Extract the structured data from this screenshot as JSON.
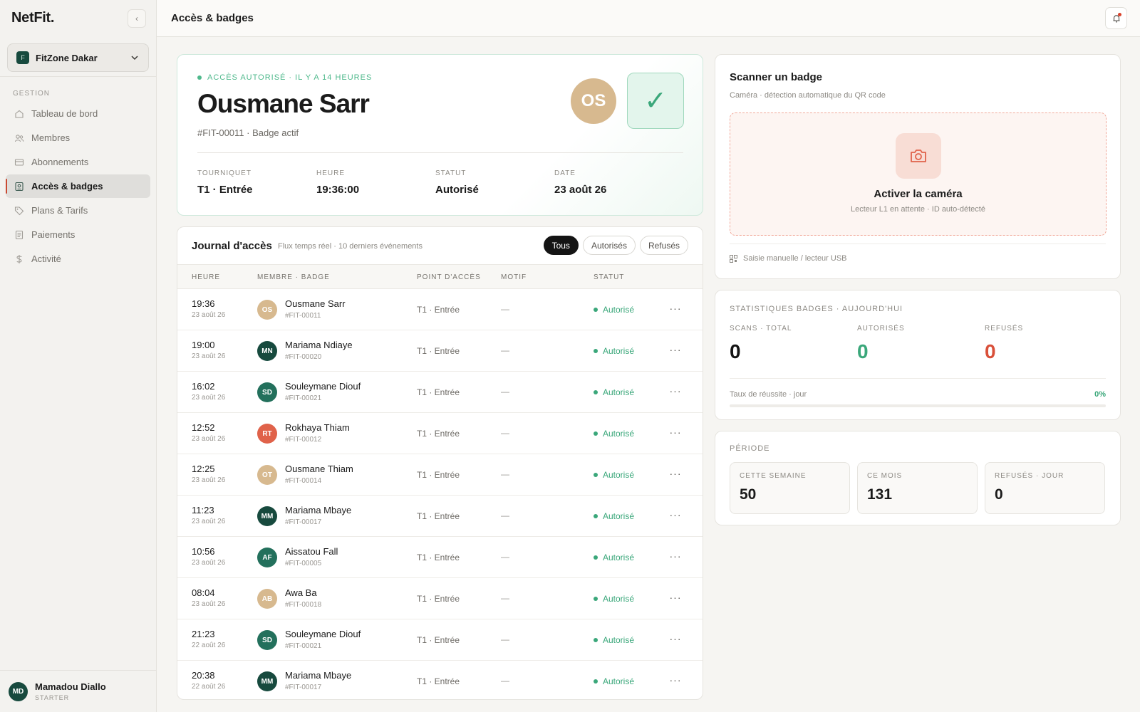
{
  "app": {
    "brand": "NetFit."
  },
  "sidebar": {
    "gym_name": "FitZone Dakar",
    "gym_initial": "F",
    "section_label": "GESTION",
    "items": [
      {
        "label": "Tableau de bord",
        "icon": "home-icon"
      },
      {
        "label": "Membres",
        "icon": "users-icon"
      },
      {
        "label": "Abonnements",
        "icon": "card-icon"
      },
      {
        "label": "Accès & badges",
        "icon": "badge-icon",
        "active": true
      },
      {
        "label": "Plans & Tarifs",
        "icon": "tag-icon"
      },
      {
        "label": "Paiements",
        "icon": "receipt-icon"
      },
      {
        "label": "Activité",
        "icon": "dollar-icon"
      }
    ],
    "user": {
      "initials": "MD",
      "name": "Mamadou Diallo",
      "plan": "STARTER"
    }
  },
  "topbar": {
    "title": "Accès & badges"
  },
  "hero": {
    "status": "ACCÈS AUTORISÉ · IL Y A 14 HEURES",
    "name": "Ousmane Sarr",
    "subtitle": "#FIT-00011 · Badge actif",
    "initials": "OS",
    "check": "✓",
    "meta": [
      {
        "label": "TOURNIQUET",
        "value": "T1 · Entrée"
      },
      {
        "label": "HEURE",
        "value": "19:36:00"
      },
      {
        "label": "STATUT",
        "value": "Autorisé"
      },
      {
        "label": "DATE",
        "value": "23 août 26"
      }
    ]
  },
  "journal": {
    "title": "Journal d'accès",
    "subtitle": "Flux temps réel · 10 derniers événements",
    "filters": [
      "Tous",
      "Autorisés",
      "Refusés"
    ],
    "active_filter": "Tous",
    "columns": [
      "HEURE",
      "MEMBRE · BADGE",
      "POINT D'ACCÈS",
      "MOTIF",
      "STATUT"
    ],
    "rows": [
      {
        "time": "19:36",
        "date": "23 août 26",
        "initials": "OS",
        "name": "Ousmane Sarr",
        "badge": "#FIT-00011",
        "point": "T1 · Entrée",
        "motif": "—",
        "status": "Autorisé",
        "color": "#d7b98f"
      },
      {
        "time": "19:00",
        "date": "23 août 26",
        "initials": "MN",
        "name": "Mariama Ndiaye",
        "badge": "#FIT-00020",
        "point": "T1 · Entrée",
        "motif": "—",
        "status": "Autorisé",
        "color": "#174a3e"
      },
      {
        "time": "16:02",
        "date": "23 août 26",
        "initials": "SD",
        "name": "Souleymane Diouf",
        "badge": "#FIT-00021",
        "point": "T1 · Entrée",
        "motif": "—",
        "status": "Autorisé",
        "color": "#23705c"
      },
      {
        "time": "12:52",
        "date": "23 août 26",
        "initials": "RT",
        "name": "Rokhaya Thiam",
        "badge": "#FIT-00012",
        "point": "T1 · Entrée",
        "motif": "—",
        "status": "Autorisé",
        "color": "#e0624a"
      },
      {
        "time": "12:25",
        "date": "23 août 26",
        "initials": "OT",
        "name": "Ousmane Thiam",
        "badge": "#FIT-00014",
        "point": "T1 · Entrée",
        "motif": "—",
        "status": "Autorisé",
        "color": "#d7b98f"
      },
      {
        "time": "11:23",
        "date": "23 août 26",
        "initials": "MM",
        "name": "Mariama Mbaye",
        "badge": "#FIT-00017",
        "point": "T1 · Entrée",
        "motif": "—",
        "status": "Autorisé",
        "color": "#174a3e"
      },
      {
        "time": "10:56",
        "date": "23 août 26",
        "initials": "AF",
        "name": "Aissatou Fall",
        "badge": "#FIT-00005",
        "point": "T1 · Entrée",
        "motif": "—",
        "status": "Autorisé",
        "color": "#23705c"
      },
      {
        "time": "08:04",
        "date": "23 août 26",
        "initials": "AB",
        "name": "Awa Ba",
        "badge": "#FIT-00018",
        "point": "T1 · Entrée",
        "motif": "—",
        "status": "Autorisé",
        "color": "#d7b98f"
      },
      {
        "time": "21:23",
        "date": "22 août 26",
        "initials": "SD",
        "name": "Souleymane Diouf",
        "badge": "#FIT-00021",
        "point": "T1 · Entrée",
        "motif": "—",
        "status": "Autorisé",
        "color": "#23705c"
      },
      {
        "time": "20:38",
        "date": "22 août 26",
        "initials": "MM",
        "name": "Mariama Mbaye",
        "badge": "#FIT-00017",
        "point": "T1 · Entrée",
        "motif": "—",
        "status": "Autorisé",
        "color": "#174a3e"
      }
    ]
  },
  "scanner": {
    "title": "Scanner un badge",
    "subtitle": "Caméra · détection automatique du QR code",
    "action": "Activer la caméra",
    "action_sub": "Lecteur L1 en attente · ID auto-détecté",
    "manual": "Saisie manuelle / lecteur USB"
  },
  "stats": {
    "title": "STATISTIQUES BADGES · AUJOURD'HUI",
    "cols": [
      {
        "label": "SCANS · TOTAL",
        "value": "0",
        "color": "#141414"
      },
      {
        "label": "AUTORISÉS",
        "value": "0",
        "color": "#3aa77a"
      },
      {
        "label": "REFUSÉS",
        "value": "0",
        "color": "#d9503a"
      }
    ],
    "rate_label": "Taux de réussite · jour",
    "rate_value": "0%",
    "rate_fraction": 0
  },
  "period": {
    "title": "PÉRIODE",
    "boxes": [
      {
        "label": "CETTE SEMAINE",
        "value": "50"
      },
      {
        "label": "CE MOIS",
        "value": "131"
      },
      {
        "label": "REFUSÉS · JOUR",
        "value": "0"
      }
    ]
  }
}
